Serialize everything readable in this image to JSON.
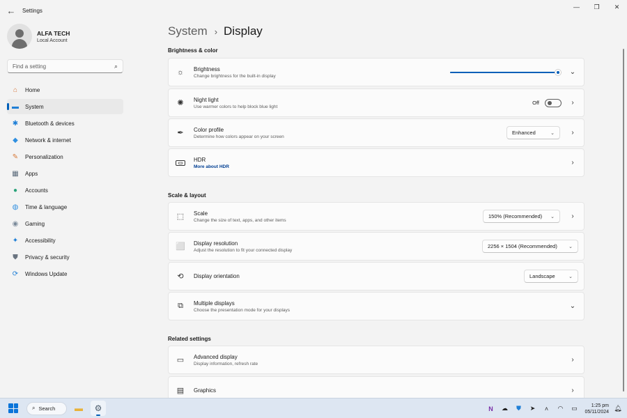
{
  "window": {
    "back_icon": "back-arrow-icon",
    "title": "Settings",
    "controls": {
      "minimize": "—",
      "maximize": "❐",
      "close": "✕"
    }
  },
  "profile": {
    "name": "ALFA TECH",
    "subtitle": "Local Account"
  },
  "search": {
    "placeholder": "Find a setting",
    "icon": "search-icon"
  },
  "sidebar": {
    "items": [
      {
        "label": "Home",
        "icon": "home-icon",
        "glyph": "⌂",
        "color": "#d6763a"
      },
      {
        "label": "System",
        "icon": "monitor-icon",
        "glyph": "▬",
        "color": "#1f7fd6",
        "selected": true
      },
      {
        "label": "Bluetooth & devices",
        "icon": "bluetooth-icon",
        "glyph": "✱",
        "color": "#1f7fd6"
      },
      {
        "label": "Network & internet",
        "icon": "wifi-icon",
        "glyph": "◆",
        "color": "#2f8fe0"
      },
      {
        "label": "Personalization",
        "icon": "brush-icon",
        "glyph": "✎",
        "color": "#d67a3a"
      },
      {
        "label": "Apps",
        "icon": "apps-icon",
        "glyph": "▦",
        "color": "#5a6a7a"
      },
      {
        "label": "Accounts",
        "icon": "person-icon",
        "glyph": "●",
        "color": "#2aa37a"
      },
      {
        "label": "Time & language",
        "icon": "globe-clock-icon",
        "glyph": "◍",
        "color": "#2f8fe0"
      },
      {
        "label": "Gaming",
        "icon": "gamepad-icon",
        "glyph": "◉",
        "color": "#7a8a9a"
      },
      {
        "label": "Accessibility",
        "icon": "accessibility-icon",
        "glyph": "✦",
        "color": "#1f7fd6"
      },
      {
        "label": "Privacy & security",
        "icon": "shield-icon",
        "glyph": "⛊",
        "color": "#6a7480"
      },
      {
        "label": "Windows Update",
        "icon": "update-icon",
        "glyph": "⟳",
        "color": "#1f7fd6"
      }
    ]
  },
  "breadcrumb": {
    "parent": "System",
    "separator": "›",
    "current": "Display"
  },
  "sections": {
    "brightness_color": "Brightness & color",
    "scale_layout": "Scale & layout",
    "related": "Related settings"
  },
  "cards": {
    "brightness": {
      "title": "Brightness",
      "desc": "Change brightness for the built-in display",
      "icon": "sun-icon",
      "level_percent": 100
    },
    "night_light": {
      "title": "Night light",
      "desc": "Use warmer colors to help block blue light",
      "icon": "night-light-icon",
      "toggle_label": "Off",
      "toggle_on": false
    },
    "color_profile": {
      "title": "Color profile",
      "desc": "Determine how colors appear on your screen",
      "icon": "eyedropper-icon",
      "value": "Enhanced"
    },
    "hdr": {
      "title": "HDR",
      "link": "More about HDR",
      "icon": "hdr-icon"
    },
    "scale": {
      "title": "Scale",
      "desc": "Change the size of text, apps, and other items",
      "icon": "scale-icon",
      "value": "150% (Recommended)"
    },
    "resolution": {
      "title": "Display resolution",
      "desc": "Adjust the resolution to fit your connected display",
      "icon": "resolution-icon",
      "value": "2256 × 1504 (Recommended)"
    },
    "orientation": {
      "title": "Display orientation",
      "icon": "orientation-icon",
      "value": "Landscape"
    },
    "multiple": {
      "title": "Multiple displays",
      "desc": "Choose the presentation mode for your displays",
      "icon": "multiple-displays-icon"
    },
    "advanced": {
      "title": "Advanced display",
      "desc": "Display information, refresh rate",
      "icon": "laptop-icon"
    },
    "graphics": {
      "title": "Graphics",
      "icon": "graphics-icon"
    }
  },
  "taskbar": {
    "search_label": "Search",
    "apps": [
      "file-explorer-icon",
      "settings-gear-icon"
    ],
    "tray": [
      "onenote-icon",
      "onedrive-icon",
      "defender-icon",
      "location-icon",
      "chevron-up-icon",
      "wifi-icon",
      "battery-icon"
    ],
    "time": "1:25 pm",
    "date": "05/11/2024"
  }
}
